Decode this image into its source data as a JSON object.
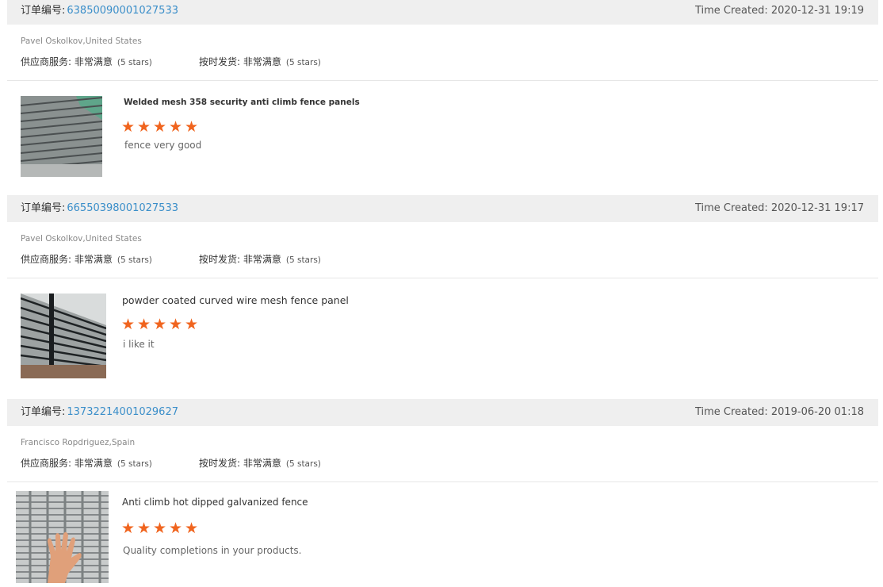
{
  "orders": [
    {
      "order_label": "订单编号:",
      "order_number": "63850090001027533",
      "time_created": "Time Created: 2020-12-31 19:19",
      "buyer": "Pavel Oskolkov,United States",
      "service_label": "供应商服务: 非常满意",
      "service_stars": "(5 stars)",
      "shipping_label": "按时发货: 非常满意",
      "shipping_stars": "(5 stars)",
      "product_title": "Welded mesh 358 security anti climb fence panels",
      "rating": 5,
      "comment": "fence very good"
    },
    {
      "order_label": "订单编号:",
      "order_number": "66550398001027533",
      "time_created": "Time Created: 2020-12-31 19:17",
      "buyer": "Pavel Oskolkov,United States",
      "service_label": "供应商服务: 非常满意",
      "service_stars": "(5 stars)",
      "shipping_label": "按时发货: 非常满意",
      "shipping_stars": "(5 stars)",
      "product_title": "powder coated curved wire mesh fence panel",
      "rating": 5,
      "comment": "i like it"
    },
    {
      "order_label": "订单编号:",
      "order_number": "13732214001029627",
      "time_created": "Time Created: 2019-06-20 01:18",
      "buyer": "Francisco Ropdriguez,Spain",
      "service_label": "供应商服务: 非常满意",
      "service_stars": "(5 stars)",
      "shipping_label": "按时发货: 非常满意",
      "shipping_stars": "(5 stars)",
      "product_title": "Anti climb hot dipped galvanized fence",
      "rating": 5,
      "comment": "Quality completions in your products."
    }
  ],
  "colors": {
    "accent": "#3a8ec9",
    "star": "#f0641e",
    "header_bg": "#efefef"
  }
}
